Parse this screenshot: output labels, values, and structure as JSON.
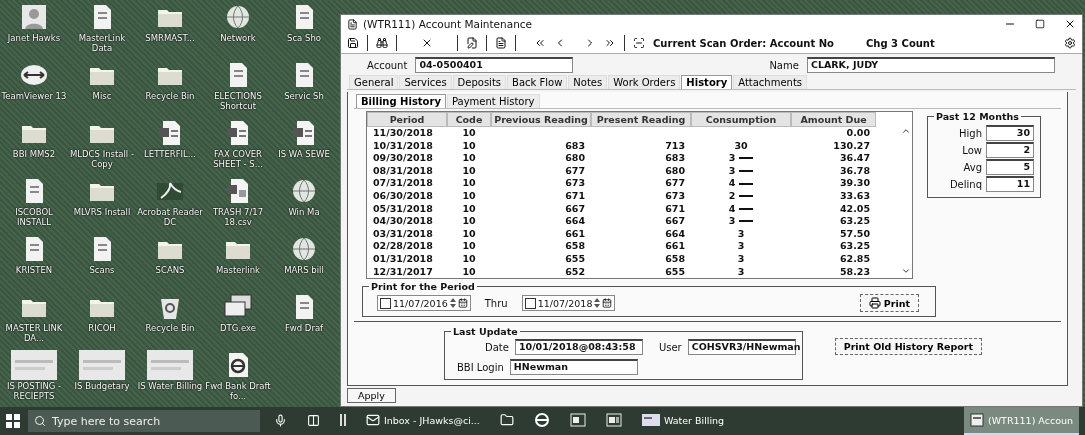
{
  "desktop": {
    "icons": [
      {
        "label": "Janet Hawks",
        "kind": "user"
      },
      {
        "label": "MasterLink Data",
        "kind": "doc"
      },
      {
        "label": "SMRMAST...",
        "kind": "folder"
      },
      {
        "label": "Network",
        "kind": "globe"
      },
      {
        "label": "Sca Sho",
        "kind": "doc"
      },
      {
        "label": "TeamViewer 13",
        "kind": "arrows"
      },
      {
        "label": "Misc",
        "kind": "folder"
      },
      {
        "label": "Recycle Bin",
        "kind": "folder"
      },
      {
        "label": "ELECTIONS Shortcut",
        "kind": "doc"
      },
      {
        "label": "Servic Sh",
        "kind": "doc"
      },
      {
        "label": "BBI MMS2",
        "kind": "folder"
      },
      {
        "label": "MLDCS Install - Copy",
        "kind": "folder"
      },
      {
        "label": "LETTERFIL...",
        "kind": "word"
      },
      {
        "label": "FAX COVER SHEET - S...",
        "kind": "word"
      },
      {
        "label": "IS WA SEWE",
        "kind": "word"
      },
      {
        "label": "ISCOBOL INSTALL",
        "kind": "doc"
      },
      {
        "label": "MLVRS Install",
        "kind": "folder"
      },
      {
        "label": "Acrobat Reader DC",
        "kind": "pdf"
      },
      {
        "label": "TRASH 7/17 18.csv",
        "kind": "sheet"
      },
      {
        "label": "Win Ma",
        "kind": "globe"
      },
      {
        "label": "KRISTEN",
        "kind": "doc"
      },
      {
        "label": "Scans",
        "kind": "doc"
      },
      {
        "label": "SCANS",
        "kind": "folder"
      },
      {
        "label": "Masterlink",
        "kind": "folder"
      },
      {
        "label": "MARS bill",
        "kind": "globe"
      },
      {
        "label": "MASTER LINK DA...",
        "kind": "folder"
      },
      {
        "label": "RICOH",
        "kind": "folder"
      },
      {
        "label": "Recycle Bin",
        "kind": "recycle"
      },
      {
        "label": "DTG.exe",
        "kind": "windows"
      },
      {
        "label": "Fwd Draf",
        "kind": "doc"
      },
      {
        "label": "IS POSTING - RECIEPTS",
        "kind": "photo"
      },
      {
        "label": "IS Budgetary",
        "kind": "photo"
      },
      {
        "label": "IS Water Billing",
        "kind": "photo"
      },
      {
        "label": "Fwd Bank Draft fo...",
        "kind": "browser"
      }
    ]
  },
  "window": {
    "title": "(WTR111) Account Maintenance",
    "toolbar": {
      "scan_order": "Current Scan Order: Account No",
      "count": "Chg 3 Count"
    },
    "account": {
      "label": "Account",
      "value": "04-0500401"
    },
    "name": {
      "label": "Name",
      "value": "CLARK, JUDY"
    },
    "tabs": [
      {
        "label": "General",
        "selected": false
      },
      {
        "label": "Services",
        "selected": false
      },
      {
        "label": "Deposits",
        "selected": false
      },
      {
        "label": "Back Flow",
        "selected": false
      },
      {
        "label": "Notes",
        "selected": false
      },
      {
        "label": "Work Orders",
        "selected": false
      },
      {
        "label": "History",
        "selected": true
      },
      {
        "label": "Attachments",
        "selected": false
      }
    ],
    "subtabs": [
      {
        "label": "Billing History",
        "selected": true
      },
      {
        "label": "Payment History",
        "selected": false
      }
    ],
    "table": {
      "columns": [
        "Period",
        "Code",
        "Previous Reading",
        "Present Reading",
        "Consumption",
        "Amount Due"
      ],
      "rows": [
        {
          "cells": [
            "11/30/2018",
            "10",
            "",
            "",
            "",
            "0.00"
          ],
          "flag": false
        },
        {
          "cells": [
            "10/31/2018",
            "10",
            "683",
            "713",
            "30",
            "130.27"
          ],
          "flag": false
        },
        {
          "cells": [
            "09/30/2018",
            "10",
            "680",
            "683",
            "3",
            "36.47"
          ],
          "flag": true
        },
        {
          "cells": [
            "08/31/2018",
            "10",
            "677",
            "680",
            "3",
            "36.78"
          ],
          "flag": true
        },
        {
          "cells": [
            "07/31/2018",
            "10",
            "673",
            "677",
            "4",
            "39.30"
          ],
          "flag": true
        },
        {
          "cells": [
            "06/30/2018",
            "10",
            "671",
            "673",
            "2",
            "33.63"
          ],
          "flag": true
        },
        {
          "cells": [
            "05/31/2018",
            "10",
            "667",
            "671",
            "4",
            "42.05"
          ],
          "flag": true
        },
        {
          "cells": [
            "04/30/2018",
            "10",
            "664",
            "667",
            "3",
            "63.25"
          ],
          "flag": true
        },
        {
          "cells": [
            "03/31/2018",
            "10",
            "661",
            "664",
            "3",
            "57.50"
          ],
          "flag": false
        },
        {
          "cells": [
            "02/28/2018",
            "10",
            "658",
            "661",
            "3",
            "63.25"
          ],
          "flag": false
        },
        {
          "cells": [
            "01/31/2018",
            "10",
            "655",
            "658",
            "3",
            "62.85"
          ],
          "flag": false
        },
        {
          "cells": [
            "12/31/2017",
            "10",
            "652",
            "655",
            "3",
            "58.23"
          ],
          "flag": false
        }
      ]
    },
    "past_12_months": {
      "title": "Past 12 Months",
      "stats": [
        {
          "label": "High",
          "value": "30"
        },
        {
          "label": "Low",
          "value": "2"
        },
        {
          "label": "Avg",
          "value": "5"
        },
        {
          "label": "Delinq",
          "value": "11"
        }
      ]
    },
    "print_period": {
      "title": "Print for the Period",
      "from": {
        "checked": false,
        "value": "11/07/2016"
      },
      "thru_label": "Thru",
      "to": {
        "checked": false,
        "value": "11/07/2018"
      },
      "print_button": "Print"
    },
    "last_update": {
      "title": "Last Update",
      "date_label": "Date",
      "date": "10/01/2018@08:43:58",
      "user_label": "User",
      "user": "COHSVR3/HNewman",
      "login_label": "BBI Login",
      "login": "HNewman"
    },
    "report_button": "Print Old History Report",
    "apply_button": "Apply"
  },
  "taskbar": {
    "search_placeholder": "Type here to search",
    "items": [
      {
        "kind": "mic",
        "selected": false
      },
      {
        "kind": "taskview",
        "selected": false
      },
      {
        "kind": "bars",
        "selected": false
      },
      {
        "kind": "mail",
        "label": "Inbox - JHawks@ci...",
        "selected": false
      },
      {
        "kind": "folder",
        "selected": false
      },
      {
        "kind": "browser",
        "selected": false
      },
      {
        "kind": "word",
        "selected": false
      },
      {
        "kind": "sheet",
        "selected": false
      },
      {
        "kind": "app",
        "label": "Water Billing",
        "selected": false
      },
      {
        "kind": "window",
        "label": "(WTR111) Accoun",
        "selected": true
      }
    ]
  }
}
